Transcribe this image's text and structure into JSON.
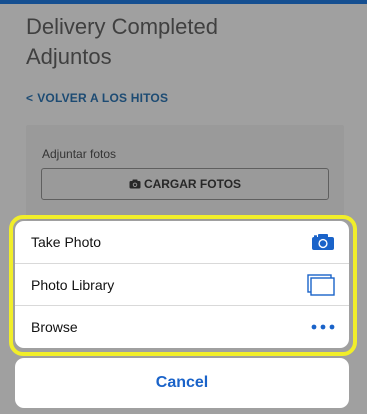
{
  "page": {
    "title_line1": "Delivery Completed",
    "title_line2": "Adjuntos",
    "back_link": "VOLVER A LOS HITOS"
  },
  "attachments": {
    "label": "Adjuntar fotos",
    "upload_button": "CARGAR FOTOS"
  },
  "action_sheet": {
    "items": [
      {
        "label": "Take Photo",
        "icon": "camera-icon"
      },
      {
        "label": "Photo Library",
        "icon": "photo-library-icon"
      },
      {
        "label": "Browse",
        "icon": "more-icon"
      }
    ],
    "cancel": "Cancel"
  },
  "colors": {
    "accent": "#1a63c9",
    "top_bar": "#1f75d6",
    "highlight": "#f1ee2a"
  }
}
